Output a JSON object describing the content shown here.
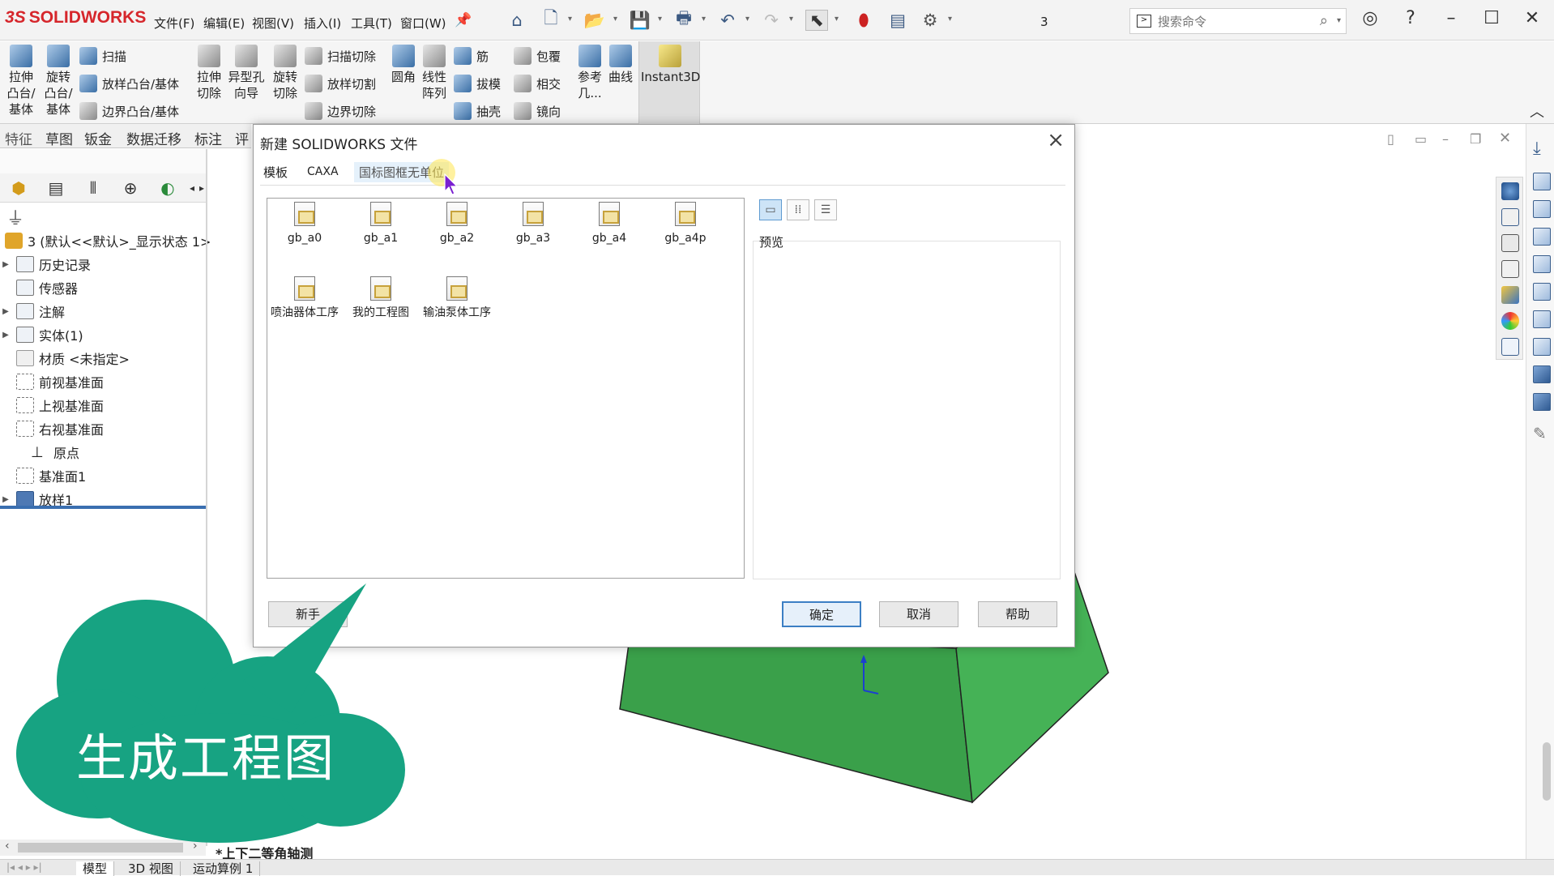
{
  "app": {
    "logo_prefix": "3S",
    "logo_text": "SOLIDWORKS",
    "menus": [
      "文件(F)",
      "编辑(E)",
      "视图(V)",
      "插入(I)",
      "工具(T)",
      "窗口(W)"
    ],
    "doc_name": "3",
    "search_placeholder": "搜索命令"
  },
  "ribbon": {
    "big": [
      {
        "label": "拉伸\n凸台/\n基体"
      },
      {
        "label": "旋转\n凸台/\n基体"
      },
      {
        "label": "拉伸\n切除"
      },
      {
        "label": "异型孔\n向导"
      },
      {
        "label": "旋转\n切除"
      },
      {
        "label": "圆角"
      },
      {
        "label": "线性\n阵列"
      },
      {
        "label": "参考\n几..."
      },
      {
        "label": "曲线"
      },
      {
        "label": "Instant3D"
      }
    ],
    "small": [
      "扫描",
      "放样凸台/基体",
      "边界凸台/基体",
      "扫描切除",
      "放样切割",
      "边界切除",
      "筋",
      "拔模",
      "抽壳",
      "包覆",
      "相交",
      "镜向"
    ]
  },
  "feature_tabs": [
    "特征",
    "草图",
    "钣金",
    "数据迁移",
    "标注",
    "评"
  ],
  "tree": {
    "root": "3 (默认<<默认>_显示状态 1>",
    "items": [
      {
        "label": "历史记录",
        "expandable": true
      },
      {
        "label": "传感器",
        "expandable": false
      },
      {
        "label": "注解",
        "expandable": true
      },
      {
        "label": "实体(1)",
        "expandable": true
      },
      {
        "label": "材质 <未指定>",
        "expandable": false
      },
      {
        "label": "前视基准面",
        "expandable": false
      },
      {
        "label": "上视基准面",
        "expandable": false
      },
      {
        "label": "右视基准面",
        "expandable": false
      },
      {
        "label": "原点",
        "expandable": false
      },
      {
        "label": "基准面1",
        "expandable": false
      },
      {
        "label": "放样1",
        "expandable": true
      }
    ]
  },
  "dialog": {
    "title": "新建 SOLIDWORKS 文件",
    "tabs": [
      "模板",
      "CAXA",
      "国标图框无单位"
    ],
    "templates": [
      "gb_a0",
      "gb_a1",
      "gb_a2",
      "gb_a3",
      "gb_a4",
      "gb_a4p",
      "喷油器体工序",
      "我的工程图",
      "输油泵体工序"
    ],
    "preview_label": "预览",
    "buttons": {
      "novice": "新手",
      "ok": "确定",
      "cancel": "取消",
      "help": "帮助"
    }
  },
  "view": {
    "label": "*上下二等角轴测"
  },
  "bottom_tabs": [
    "模型",
    "3D 视图",
    "运动算例 1"
  ],
  "overlay": {
    "cloud_text": "生成工程图"
  },
  "colors": {
    "brand": "#d6262b",
    "shape": "#3aa04a",
    "cloud": "#17a382",
    "selection": "#3a6fb0"
  }
}
